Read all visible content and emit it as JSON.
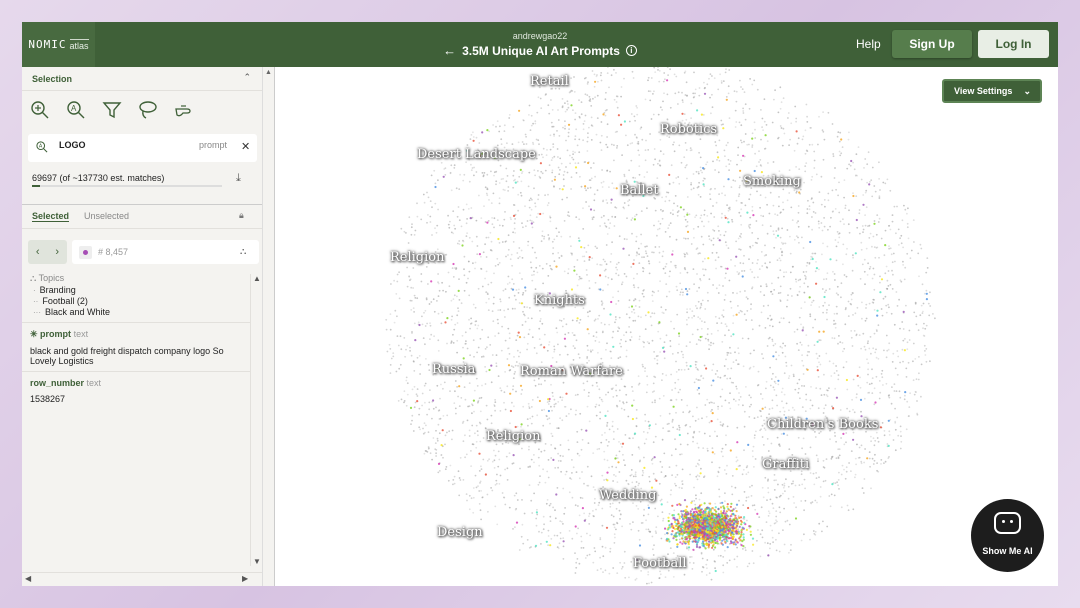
{
  "header": {
    "logo_text": "NOMIC",
    "logo_sub": "atlas",
    "user": "andrewgao22",
    "title": "3.5M Unique AI Art Prompts",
    "help_label": "Help",
    "signup_label": "Sign Up",
    "login_label": "Log In"
  },
  "sidebar": {
    "section_title": "Selection",
    "tools": [
      "zoom-in-icon",
      "search-icon",
      "filter-icon",
      "lasso-icon",
      "hand-pointer-icon"
    ],
    "search": {
      "query": "LOGO",
      "field": "prompt"
    },
    "matches_text": "69697 (of ~137730 est. matches)",
    "match_progress": 0.04,
    "tab_selected": "Selected",
    "tab_unselected": "Unselected",
    "record_id": "# 8,457",
    "topics_label": "Topics",
    "topics": [
      {
        "dots": "·",
        "label": "Branding"
      },
      {
        "dots": "··",
        "label": "Football (2)"
      },
      {
        "dots": "···",
        "label": "Black and White"
      }
    ],
    "fields": [
      {
        "name": "prompt",
        "type": "text",
        "value": "black and gold freight dispatch company logo So Lovely Logistics"
      },
      {
        "name": "row_number",
        "type": "text",
        "value": "1538267"
      }
    ]
  },
  "map": {
    "view_settings_label": "View Settings",
    "clusters": [
      "Retail",
      "Robotics",
      "Desert Landscape",
      "Smoking",
      "Ballet",
      "Religion",
      "Knights",
      "Russia",
      "Roman Warfare",
      "Religion",
      "Children's Books",
      "Graffiti",
      "Wedding",
      "Design",
      "Football"
    ],
    "accent_colors": [
      "#e8533b",
      "#f5a623",
      "#d63ab4",
      "#4a90e2",
      "#7ed321",
      "#f8e71c",
      "#9b59b6",
      "#50e3c2"
    ]
  },
  "overlay": {
    "show_me_ai_label": "Show Me AI"
  },
  "colors": {
    "brand_green": "#3f6038",
    "accent_green": "#567d4c"
  }
}
